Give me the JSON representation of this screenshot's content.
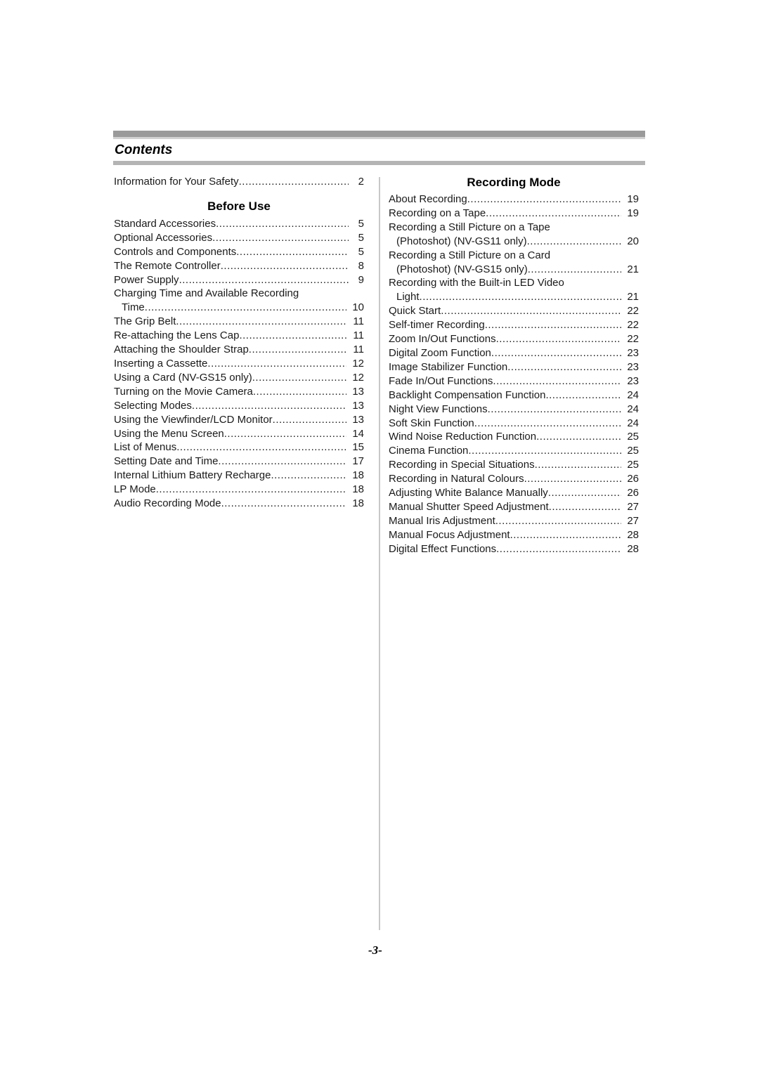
{
  "title": "Contents",
  "left_column": {
    "intro": {
      "label": "Information for Your Safety",
      "page": "2"
    },
    "heading": "Before Use",
    "entries": [
      {
        "label": "Standard Accessories",
        "page": "5"
      },
      {
        "label": "Optional Accessories",
        "page": "5"
      },
      {
        "label": "Controls and Components",
        "page": "5"
      },
      {
        "label": "The Remote Controller",
        "page": "8"
      },
      {
        "label": "Power Supply",
        "page": "9"
      },
      {
        "label": "Charging Time and Available Recording",
        "continuation": "Time",
        "page": "10"
      },
      {
        "label": "The Grip Belt",
        "page": "11"
      },
      {
        "label": "Re-attaching the Lens Cap",
        "page": "11"
      },
      {
        "label": "Attaching the Shoulder Strap",
        "page": "11"
      },
      {
        "label": "Inserting a Cassette",
        "page": "12"
      },
      {
        "label": "Using a Card (NV-GS15 only)",
        "page": "12"
      },
      {
        "label": "Turning on the Movie Camera",
        "page": "13"
      },
      {
        "label": "Selecting Modes",
        "page": "13"
      },
      {
        "label": "Using the Viewfinder/LCD Monitor",
        "page": "13"
      },
      {
        "label": "Using the Menu Screen",
        "page": "14"
      },
      {
        "label": "List of Menus",
        "page": "15"
      },
      {
        "label": "Setting Date and Time",
        "page": "17"
      },
      {
        "label": "Internal Lithium Battery Recharge",
        "page": "18"
      },
      {
        "label": "LP Mode",
        "page": "18"
      },
      {
        "label": "Audio Recording Mode",
        "page": "18"
      }
    ]
  },
  "right_column": {
    "heading": "Recording Mode",
    "entries": [
      {
        "label": "About Recording",
        "page": "19"
      },
      {
        "label": "Recording on a Tape",
        "page": "19"
      },
      {
        "label": "Recording a Still Picture on a Tape",
        "continuation": "(Photoshot) (NV-GS11 only)",
        "page": "20"
      },
      {
        "label": "Recording a Still Picture on a Card",
        "continuation": "(Photoshot) (NV-GS15 only)",
        "page": "21"
      },
      {
        "label": "Recording with the Built-in LED Video",
        "continuation": "Light",
        "page": "21"
      },
      {
        "label": "Quick Start",
        "page": "22"
      },
      {
        "label": "Self-timer Recording",
        "page": "22"
      },
      {
        "label": "Zoom In/Out Functions",
        "page": "22"
      },
      {
        "label": "Digital Zoom Function",
        "page": "23"
      },
      {
        "label": "Image Stabilizer Function",
        "page": "23"
      },
      {
        "label": "Fade In/Out Functions",
        "page": "23"
      },
      {
        "label": "Backlight Compensation Function",
        "page": "24"
      },
      {
        "label": "Night View Functions",
        "page": "24"
      },
      {
        "label": "Soft Skin Function",
        "page": "24"
      },
      {
        "label": "Wind Noise Reduction Function",
        "page": "25"
      },
      {
        "label": "Cinema Function",
        "page": "25"
      },
      {
        "label": "Recording in Special Situations",
        "page": "25"
      },
      {
        "label": "Recording in Natural Colours",
        "page": "26"
      },
      {
        "label": "Adjusting White Balance Manually",
        "page": "26"
      },
      {
        "label": "Manual Shutter Speed Adjustment",
        "page": "27"
      },
      {
        "label": "Manual Iris Adjustment",
        "page": "27"
      },
      {
        "label": "Manual Focus Adjustment",
        "page": "28"
      },
      {
        "label": "Digital Effect Functions",
        "page": "28"
      }
    ]
  },
  "page_number": "-3-"
}
